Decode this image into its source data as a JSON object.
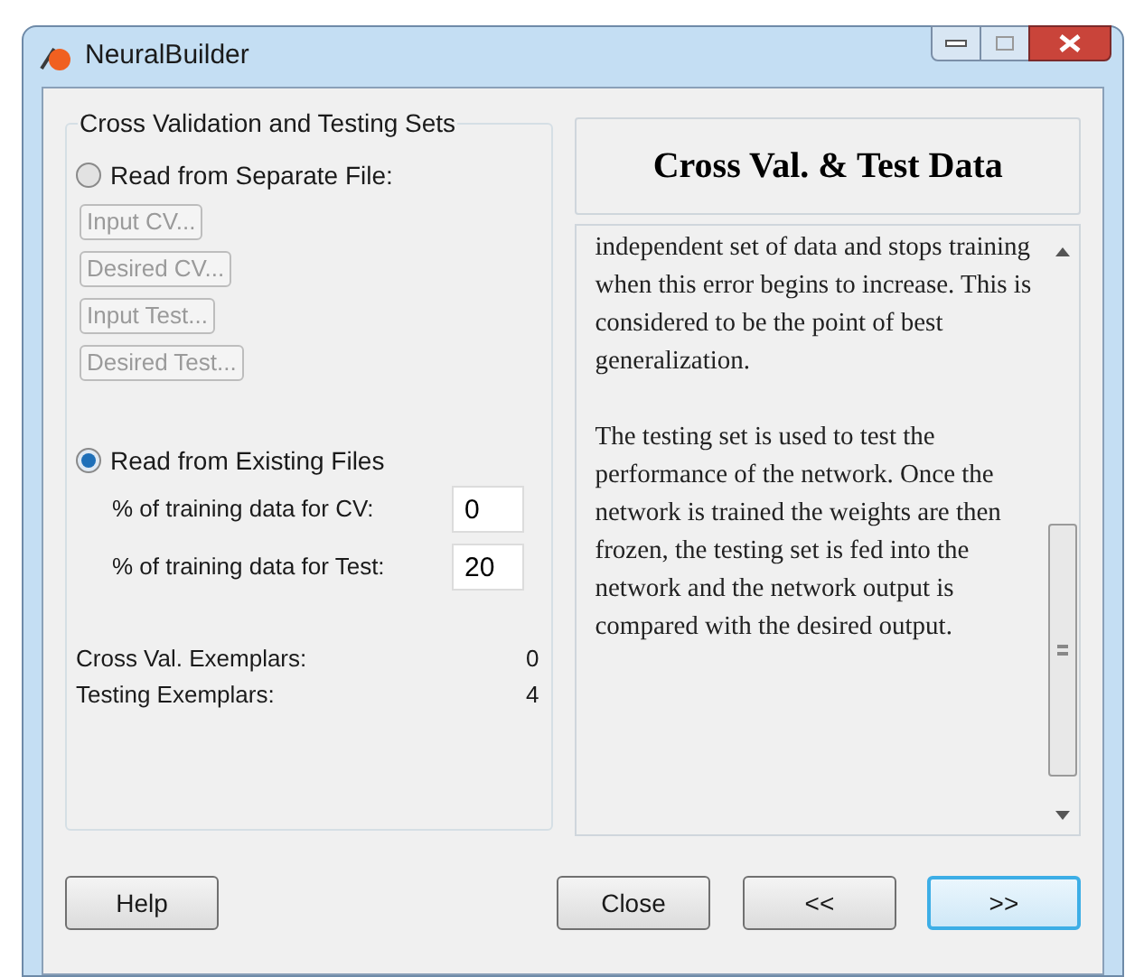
{
  "window": {
    "title": "NeuralBuilder"
  },
  "group": {
    "title": "Cross Validation and Testing Sets",
    "options": [
      {
        "label": "Read from Separate File:",
        "selected": false
      },
      {
        "label": "Read from Existing Files",
        "selected": true
      }
    ],
    "file_buttons": [
      {
        "label": "Input CV...",
        "disabled": true
      },
      {
        "label": "Desired CV...",
        "disabled": true
      },
      {
        "label": "Input Test...",
        "disabled": true
      },
      {
        "label": "Desired Test...",
        "disabled": true
      }
    ],
    "fields": [
      {
        "label": "% of training data for CV:",
        "value": "0"
      },
      {
        "label": "% of training data for Test:",
        "value": "20"
      }
    ],
    "stats": [
      {
        "label": "Cross Val. Exemplars:",
        "value": "0"
      },
      {
        "label": "Testing Exemplars:",
        "value": "4"
      }
    ]
  },
  "help_panel": {
    "title": "Cross Val. & Test Data",
    "paragraphs": [
      "independent set of data and stops training when this error begins to increase. This is considered to be the point of best generalization.",
      "The testing set is used to test the performance of the network. Once the network is trained the weights are then frozen, the testing set is fed into the network and the network output is compared with the desired output."
    ]
  },
  "buttons": [
    {
      "label": "Help",
      "focused": false
    },
    {
      "label": "Close",
      "focused": false
    },
    {
      "label": "<<",
      "focused": false
    },
    {
      "label": ">>",
      "focused": true
    }
  ]
}
